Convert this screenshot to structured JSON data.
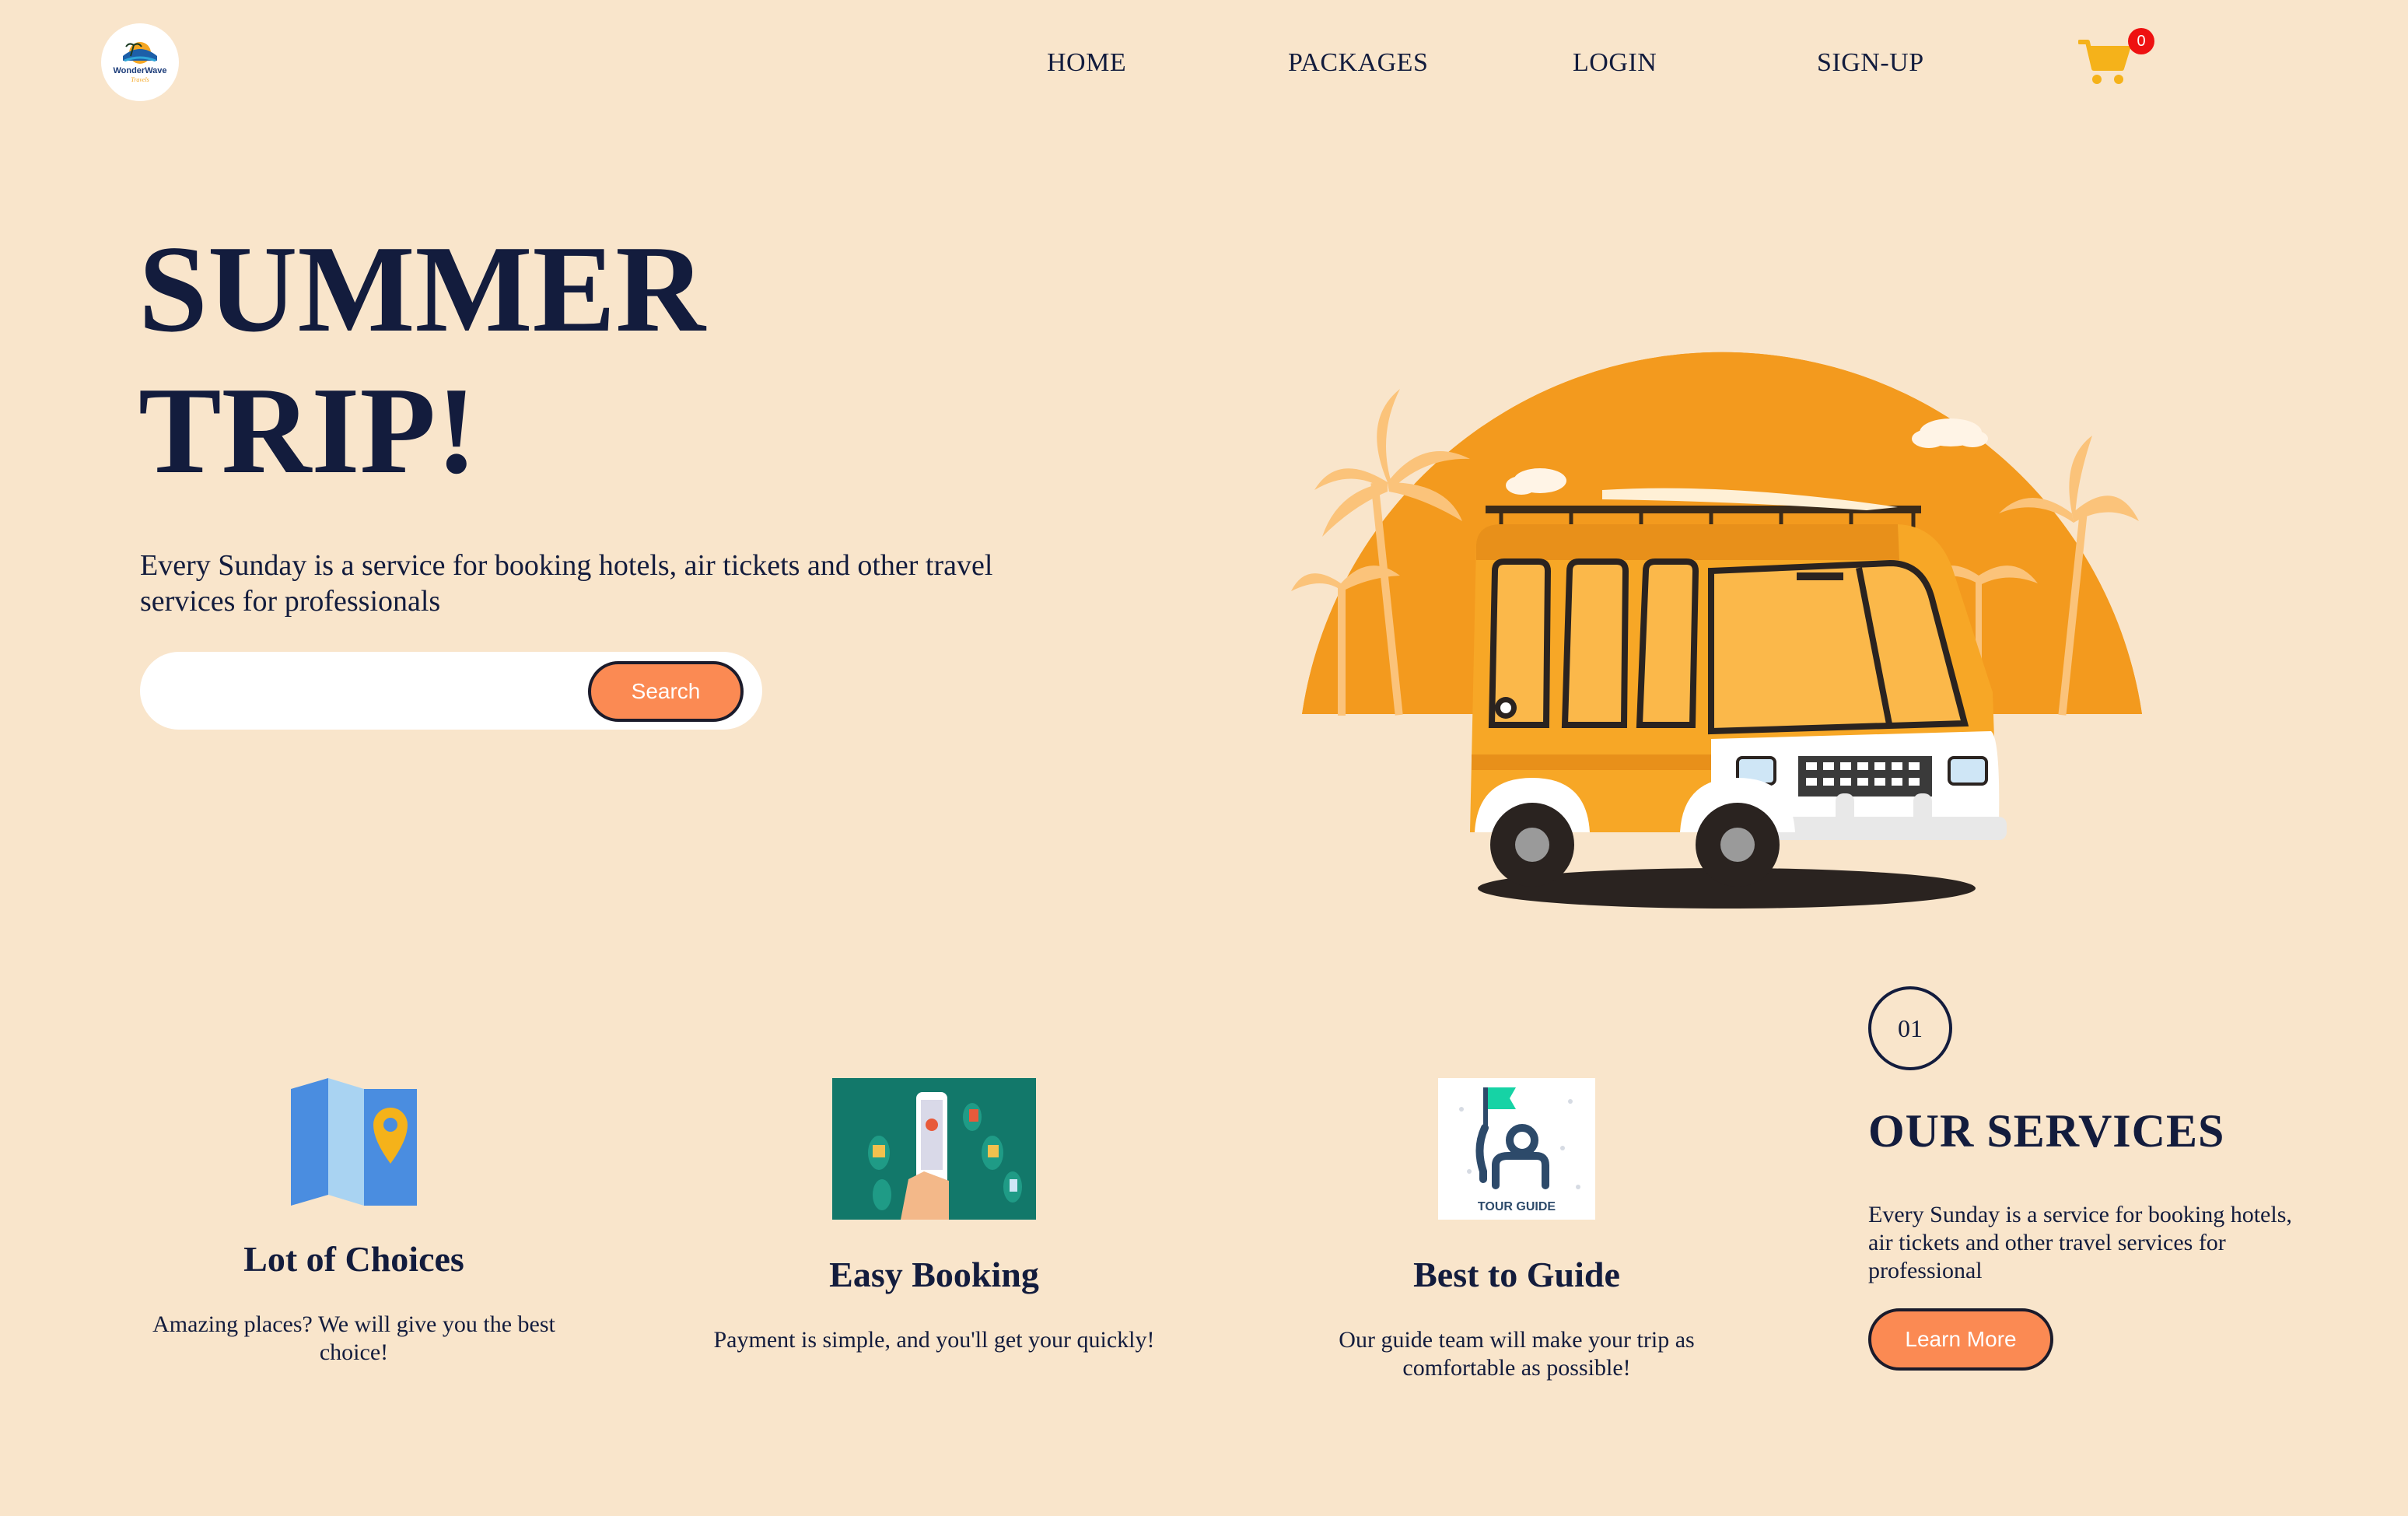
{
  "brand": {
    "logo_text": "WonderWave",
    "logo_sub": "Travels"
  },
  "nav": {
    "items": [
      {
        "label": "HOME"
      },
      {
        "label": "PACKAGES"
      },
      {
        "label": "LOGIN"
      },
      {
        "label": "SIGN-UP"
      }
    ],
    "cart_count": "0",
    "cart_icon": "shopping-cart-icon"
  },
  "hero": {
    "title_line1": "SUMMER",
    "title_line2": "TRIP!",
    "description": "Every Sunday is a service for booking hotels, air tickets and other travel services for professionals",
    "search": {
      "placeholder": "",
      "value": "",
      "button_label": "Search"
    },
    "illustration": "orange-van-beach-sunset"
  },
  "features": [
    {
      "icon": "map-pin-icon",
      "title": "Lot of Choices",
      "description": "Amazing places? We will give you the best choice!"
    },
    {
      "icon": "phone-booking-icon",
      "title": "Easy Booking",
      "description": "Payment is simple, and you'll get your quickly!"
    },
    {
      "icon": "tour-guide-icon",
      "icon_label": "TOUR GUIDE",
      "title": "Best to Guide",
      "description": "Our guide team will make your trip as comfortable as possible!"
    }
  ],
  "services": {
    "step": "01",
    "title": "OUR SERVICES",
    "description": "Every Sunday is a service for booking hotels, air tickets and other travel services for professional",
    "button_label": "Learn More"
  },
  "colors": {
    "background": "#f9e5cb",
    "text": "#131c3d",
    "accent": "#fb8a53",
    "sun": "#f39a1e",
    "cart": "#f5b21a",
    "badge": "#ee1111"
  }
}
